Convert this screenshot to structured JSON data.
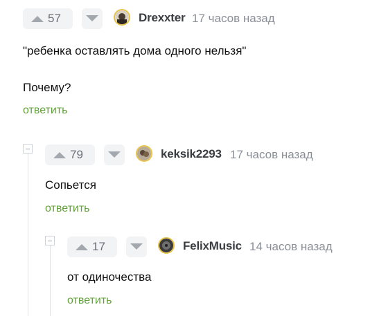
{
  "comments": [
    {
      "votes": "57",
      "author": "Drexxter",
      "time": "17 часов назад",
      "text_lines": [
        "\"ребенка оставлять дома одного нельзя\"",
        "Почему?"
      ],
      "reply_label": "ответить"
    },
    {
      "votes": "79",
      "author": "keksik2293",
      "time": "17 часов назад",
      "text_lines": [
        "Сопьется"
      ],
      "reply_label": "ответить"
    },
    {
      "votes": "17",
      "author": "FelixMusic",
      "time": "14 часов назад",
      "text_lines": [
        "от одиночества"
      ],
      "reply_label": "ответить"
    }
  ],
  "colors": {
    "reply_link": "#64a03c",
    "vote_bg": "#f2f3f5",
    "avatar_ring": "#e8c44a",
    "thread_line": "#dfe1e5"
  },
  "icons": {
    "upvote": "triangle-up-icon",
    "downvote": "triangle-down-icon",
    "collapse": "collapse-minus-icon"
  }
}
